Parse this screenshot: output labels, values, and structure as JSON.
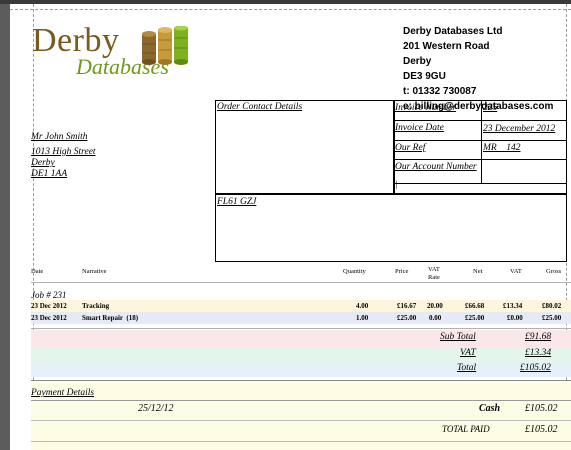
{
  "logo": {
    "word1": "Derby",
    "word2": "Databases"
  },
  "company": {
    "name": "Derby Databases Ltd",
    "street": "201 Western Road",
    "city": "Derby",
    "postcode": "DE3 9GU",
    "phone": "t: 01332 730087",
    "email": "e: billing@derbydatabases.com"
  },
  "customer": {
    "name": "Mr John Smith",
    "street": "1013 High Street",
    "city": "Derby",
    "postcode": "DE1 1AA"
  },
  "order_contact": {
    "label": "Order Contact Details"
  },
  "invoice": {
    "number_label": "Invoice Number",
    "number": "225",
    "date_label": "Invoice Date",
    "date": "23 December 2012",
    "ref_label": "Our Ref",
    "ref": "MR    142",
    "account_label": "Our Account Number",
    "extra": "|"
  },
  "vehicle": {
    "reg": "FL61 GZJ"
  },
  "columns": {
    "date": "Date",
    "narrative": "Narrative",
    "quantity": "Quantity",
    "price": "Price",
    "vat_rate_1": "VAT",
    "vat_rate_2": "Rate",
    "net": "Net",
    "vat": "VAT",
    "gross": "Gross"
  },
  "job": {
    "label": "Job # 231"
  },
  "lines": [
    {
      "date": "23 Dec 2012",
      "narrative": "Tracking",
      "quantity": "4.00",
      "price": "£16.67",
      "vat_rate": "20.00",
      "net": "£66.68",
      "vat": "£13.34",
      "gross": "£80.02"
    },
    {
      "date": "23 Dec 2012",
      "narrative": "Smart Repair  (18)",
      "quantity": "1.00",
      "price": "£25.00",
      "vat_rate": "0.00",
      "net": "£25.00",
      "vat": "£0.00",
      "gross": "£25.00"
    }
  ],
  "totals": {
    "sub_total_label": "Sub Total",
    "sub_total": "£91.68",
    "vat_label": "VAT",
    "vat": "£13.34",
    "total_label": "Total",
    "total": "£105.02"
  },
  "payment": {
    "header": "Payment Details",
    "date": "25/12/12",
    "method": "Cash",
    "amount": "£105.02",
    "total_paid_label": "TOTAL PAID",
    "total_paid": "£105.02"
  },
  "colors": {
    "row1_bg": "#fdf6dc",
    "row2_bg": "#e6eaf6",
    "subtotal_bg": "#fbe6ea",
    "vat_bg": "#e4f6ec",
    "total_bg": "#e6f0fb",
    "payment_bg": "#fdfde6"
  }
}
